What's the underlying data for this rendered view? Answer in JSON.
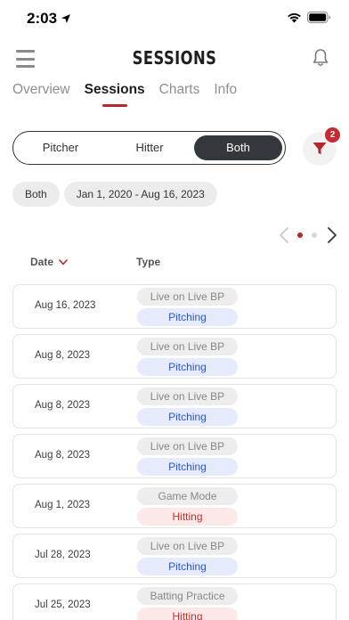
{
  "status_bar": {
    "time": "2:03"
  },
  "nav": {
    "title": "SESSIONS"
  },
  "tabs": [
    {
      "label": "Overview",
      "active": false
    },
    {
      "label": "Sessions",
      "active": true
    },
    {
      "label": "Charts",
      "active": false
    },
    {
      "label": "Info",
      "active": false
    }
  ],
  "segment": {
    "options": [
      "Pitcher",
      "Hitter",
      "Both"
    ],
    "selected": "Both"
  },
  "filter": {
    "badge_count": "2"
  },
  "chips": [
    "Both",
    "Jan 1, 2020 - Aug 16, 2023"
  ],
  "pager": {
    "pages": 2,
    "current": 1
  },
  "table": {
    "headers": {
      "date": "Date",
      "type": "Type"
    },
    "rows": [
      {
        "date": "Aug 16, 2023",
        "mode": "Live on Live BP",
        "category": "Pitching"
      },
      {
        "date": "Aug 8, 2023",
        "mode": "Live on Live BP",
        "category": "Pitching"
      },
      {
        "date": "Aug 8, 2023",
        "mode": "Live on Live BP",
        "category": "Pitching"
      },
      {
        "date": "Aug 8, 2023",
        "mode": "Live on Live BP",
        "category": "Pitching"
      },
      {
        "date": "Aug 1, 2023",
        "mode": "Game Mode",
        "category": "Hitting"
      },
      {
        "date": "Jul 28, 2023",
        "mode": "Live on Live BP",
        "category": "Pitching"
      },
      {
        "date": "Jul 25, 2023",
        "mode": "Batting Practice",
        "category": "Hitting"
      }
    ]
  },
  "colors": {
    "accent_red": "#b5272d",
    "badge_red": "#c62b31",
    "pitching_text": "#2f57c8",
    "pitching_bg": "#e6ebfb",
    "hitting_text": "#c3312f",
    "hitting_bg": "#fbe8e7",
    "segment_active": "#34383d"
  },
  "icons": {
    "location": "location-arrow-icon",
    "wifi": "wifi-icon",
    "battery": "battery-icon",
    "menu": "hamburger-menu-icon",
    "bell": "bell-icon",
    "filter": "funnel-filter-icon",
    "sort": "chevron-down-icon",
    "prev": "chevron-left-icon",
    "next": "chevron-right-icon"
  }
}
